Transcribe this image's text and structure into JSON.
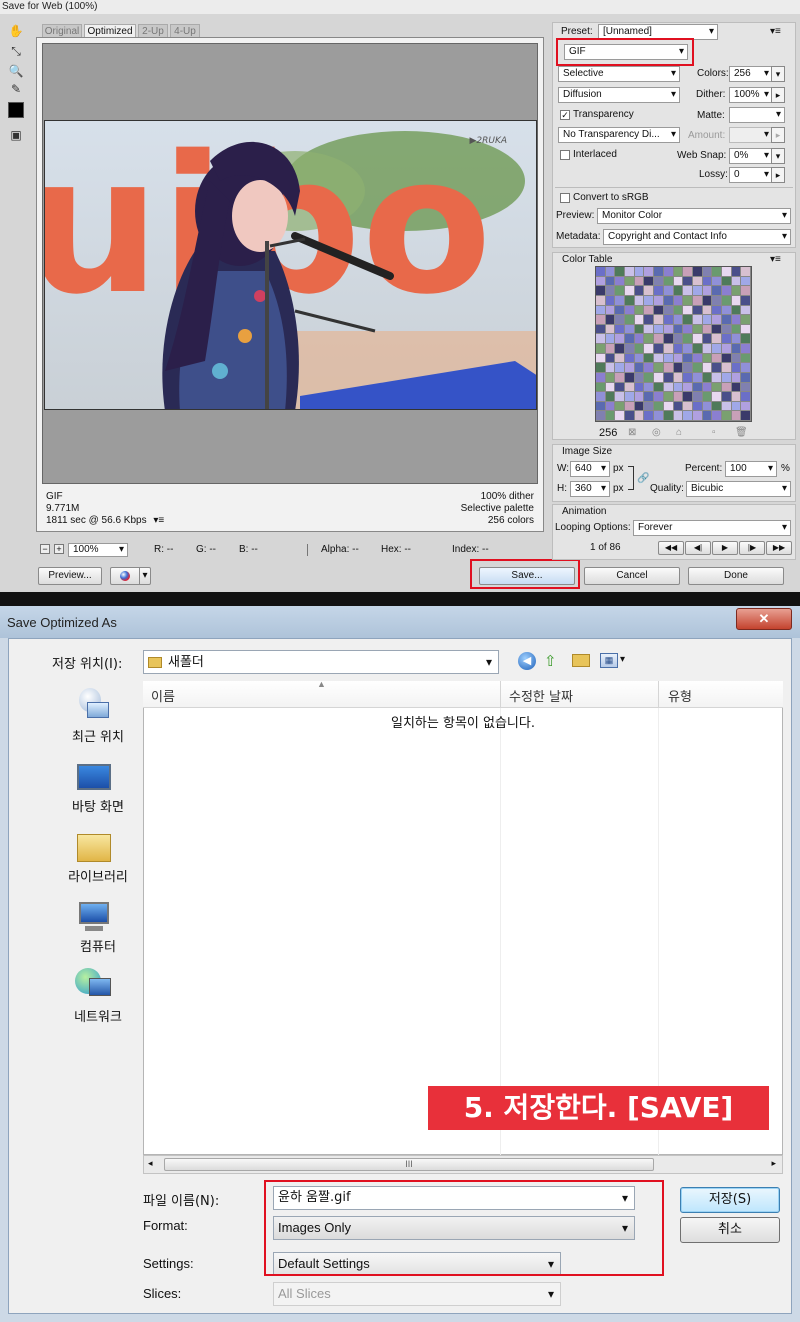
{
  "save_for_web": {
    "title": "Save for Web (100%)",
    "tabs": [
      "Original",
      "Optimized",
      "2-Up",
      "4-Up"
    ],
    "active_tab": "Optimized",
    "watermark": "▶2RUKA",
    "info_left": [
      "GIF",
      "9.771M",
      "1811 sec @ 56.6 Kbps"
    ],
    "info_left_menu": "▾≡",
    "info_right": [
      "100% dither",
      "Selective palette",
      "256 colors"
    ],
    "status": {
      "zoom_minus": "−",
      "zoom_plus": "+",
      "zoom": "100%",
      "r": "R: --",
      "g": "G: --",
      "b": "B: --",
      "alpha": "Alpha: --",
      "hex": "Hex: --",
      "index": "Index: --"
    },
    "buttons": {
      "preview": "Preview...",
      "save": "Save...",
      "cancel": "Cancel",
      "done": "Done"
    },
    "settings": {
      "preset_label": "Preset:",
      "preset_value": "[Unnamed]",
      "format_value": "GIF",
      "reduction_value": "Selective",
      "colors_label": "Colors:",
      "colors_value": "256",
      "dither_algo_value": "Diffusion",
      "dither_label": "Dither:",
      "dither_value": "100%",
      "transparency_label": "Transparency",
      "transparency_checked": "✓",
      "matte_label": "Matte:",
      "transparency_dither_value": "No Transparency Di...",
      "amount_label": "Amount:",
      "interlaced_label": "Interlaced",
      "web_snap_label": "Web Snap:",
      "web_snap_value": "0%",
      "lossy_label": "Lossy:",
      "lossy_value": "0",
      "convert_label": "Convert to sRGB",
      "preview_label": "Preview:",
      "preview_value": "Monitor Color",
      "metadata_label": "Metadata:",
      "metadata_value": "Copyright and Contact Info",
      "panel_menu": "▾≡"
    },
    "color_table": {
      "title": "Color Table",
      "count": "256",
      "menu": "▾≡"
    },
    "image_size": {
      "title": "Image Size",
      "w_label": "W:",
      "w_value": "640",
      "h_label": "H:",
      "h_value": "360",
      "unit": "px",
      "percent_label": "Percent:",
      "percent_value": "100",
      "percent_unit": "%",
      "quality_label": "Quality:",
      "quality_value": "Bicubic"
    },
    "animation": {
      "title": "Animation",
      "looping_label": "Looping Options:",
      "looping_value": "Forever",
      "frame_text": "1 of 86"
    }
  },
  "save_dialog": {
    "title": "Save Optimized As",
    "close": "✕",
    "location_label": "저장 위치(I):",
    "location_value": "새폴더",
    "places": [
      "최근 위치",
      "바탕 화면",
      "라이브러리",
      "컴퓨터",
      "네트워크"
    ],
    "columns": [
      "이름",
      "수정한 날짜",
      "유형"
    ],
    "empty_text": "일치하는 항목이 없습니다.",
    "scroll_grip": "III",
    "filename_label": "파일 이름(N):",
    "filename_value": "윤하 움짤.gif",
    "format_label": "Format:",
    "format_value": "Images Only",
    "settings_label": "Settings:",
    "settings_value": "Default Settings",
    "slices_label": "Slices:",
    "slices_value": "All Slices",
    "save_button": "저장(S)",
    "cancel_button": "취소"
  },
  "annotation": {
    "banner": "5. 저장한다. [SAVE]"
  },
  "colors": {
    "highlight": "#e01020",
    "banner_bg": "#e8303a"
  }
}
